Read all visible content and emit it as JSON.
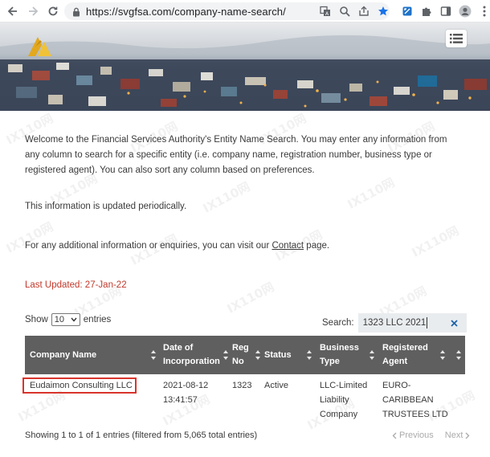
{
  "browser": {
    "url": "https://svgfsa.com/company-name-search/",
    "icons": [
      "back-arrow-icon",
      "forward-arrow-icon",
      "reload-icon",
      "lock-icon",
      "translate-icon",
      "zoom-icon",
      "share-icon",
      "bookmark-star-icon",
      "extension-icon",
      "puzzle-icon",
      "sidebar-icon",
      "profile-icon",
      "kebab-menu-icon"
    ]
  },
  "intro": {
    "text": "Welcome to the Financial Services Authority's Entity Name Search. You may enter any information from any column to search for a specific entity (i.e. company name, registration number, business type or registered agent). You can also sort any column based on preferences.",
    "periodic": "This information is updated periodically.",
    "enquiry_prefix": "For any additional information or enquiries, you can visit our ",
    "contact_link": "Contact",
    "enquiry_suffix": " page.",
    "last_updated": "Last Updated:  27-Jan-22"
  },
  "controls": {
    "show_label": "Show",
    "entries_value": "10",
    "entries_label": "entries",
    "search_label": "Search:",
    "search_value": "1323 LLC 2021"
  },
  "table": {
    "headers": [
      "Company Name",
      "Date of Incorporation",
      "Reg No",
      "Status",
      "Business Type",
      "Registered Agent"
    ],
    "rows": [
      {
        "company_name": "Eudaimon Consulting LLC",
        "date_line1": "2021-08-12",
        "date_line2": "13:41:57",
        "reg_no": "1323",
        "status": "Active",
        "business_type_lines": [
          "LLC-Limited",
          "Liability",
          "Company"
        ],
        "agent_lines": [
          "EURO-",
          "CARIBBEAN",
          "TRUSTEES LTD"
        ]
      }
    ]
  },
  "footer": {
    "info": "Showing 1 to 1 of 1 entries (filtered from 5,065 total entries)",
    "previous": "Previous",
    "next": "Next"
  },
  "watermark": "IX110网",
  "colors": {
    "header_bg": "#5f5f5f",
    "last_updated": "#c0392b",
    "highlight_border": "#d9342b",
    "search_bg": "#e9ecef",
    "star": "#1a73e8"
  }
}
